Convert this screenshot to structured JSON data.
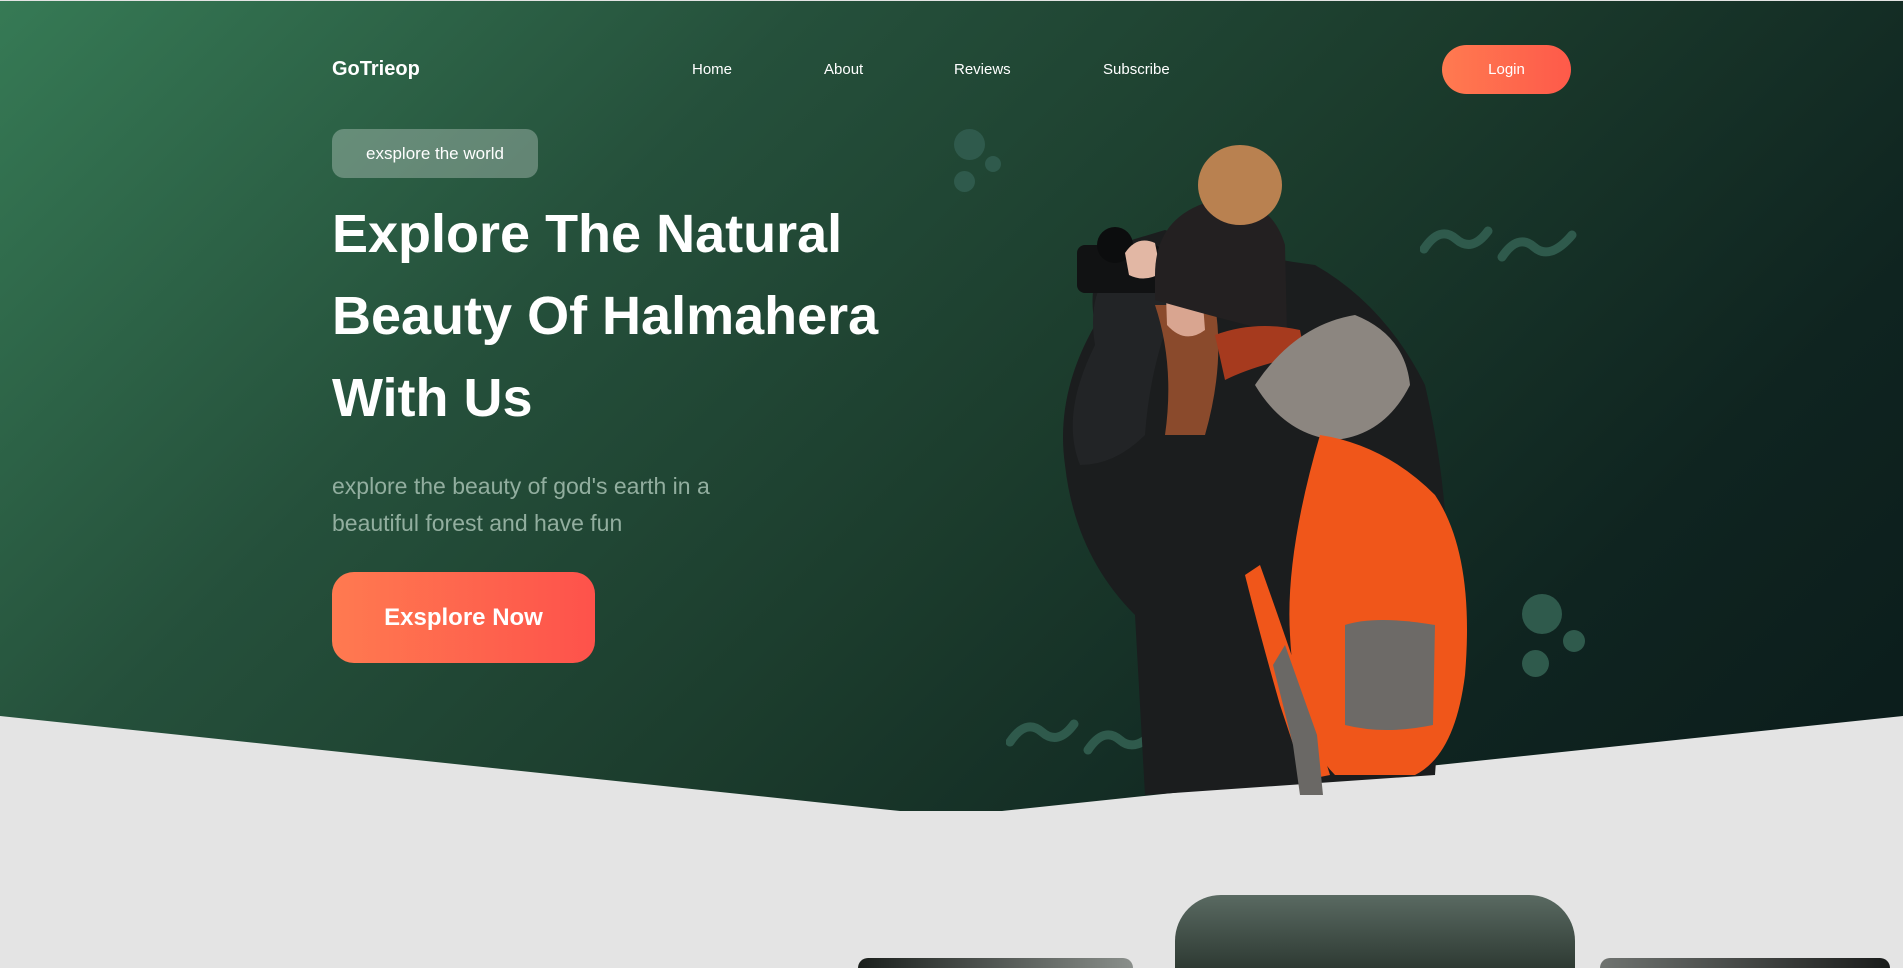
{
  "nav": {
    "logo": "GoTrieop",
    "items": [
      {
        "label": "Home"
      },
      {
        "label": "About"
      },
      {
        "label": "Reviews"
      },
      {
        "label": "Subscribe"
      }
    ],
    "login_label": "Login"
  },
  "hero": {
    "tag": "exsplore the world",
    "headline": [
      "Explore The Natural",
      "Beauty Of Halmahera",
      "With Us"
    ],
    "subtitle": "explore the beauty of god's earth in a beautiful forest and have fun",
    "cta_label": "Exsplore Now"
  },
  "colors": {
    "accent": "#ff6b4e",
    "hero_green": "#2b5a43",
    "hero_dark": "#0b1c1b",
    "page_bg": "#e4e4e4",
    "decor": "#2f5a4c"
  }
}
